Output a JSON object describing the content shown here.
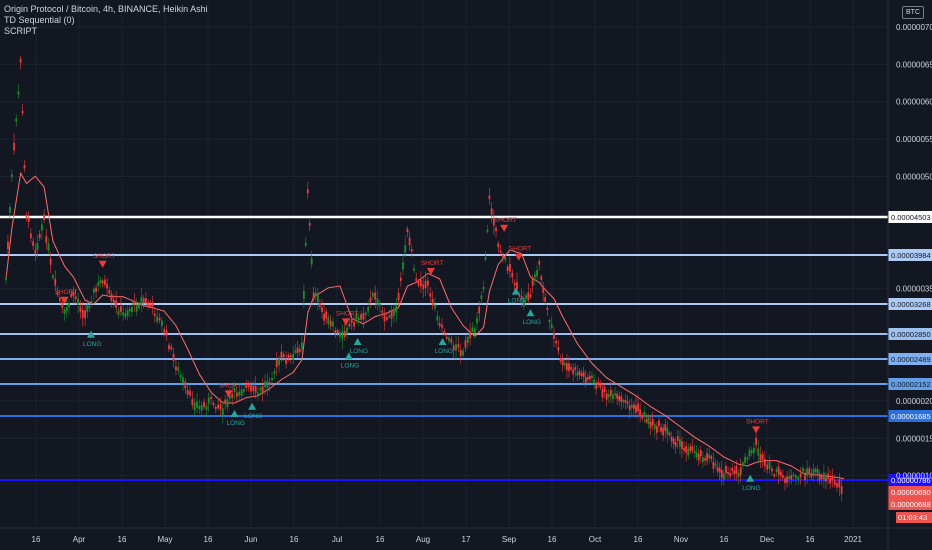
{
  "header": {
    "symbol_line": "Origin Protocol / Bitcoin, 4h, BINANCE, Heikin Ashi",
    "indicator_1": "TD Sequential (0)",
    "indicator_2": "SCRIPT",
    "currency_badge": "BTC"
  },
  "colors": {
    "background": "#131722",
    "up": "#26a69a",
    "up_candle": "#1b8f2a",
    "down": "#ef3a3a",
    "resistance_white": "#ffffff",
    "line_light": "#aecbf6",
    "line_mid": "#64a0e8",
    "line_strong": "#2962ff",
    "line_blue_deep": "#1b10ff",
    "ma_line": "#ff6b6b",
    "axis_text": "#d1d4dc",
    "countdown_bg": "#ef5350"
  },
  "chart_data": {
    "type": "candlestick",
    "title": "Origin Protocol / Bitcoin, 4h, BINANCE, Heikin Ashi",
    "y_axis": {
      "unit": "BTC",
      "range": [
        3e-07,
        7.2e-06
      ],
      "ticks": [
        "0.00000700",
        "0.00000650",
        "0.00000600",
        "0.00000550",
        "0.00000500",
        "0.00000350",
        "0.00000200",
        "0.00000150",
        "0.00000100"
      ],
      "tick_values": [
        7e-06,
        6.5e-06,
        6e-06,
        5.5e-06,
        5e-06,
        3.5e-06,
        2e-06,
        1.5e-06,
        1e-06
      ]
    },
    "x_axis": {
      "labels": [
        "16",
        "Apr",
        "16",
        "May",
        "16",
        "Jun",
        "16",
        "Jul",
        "16",
        "Aug",
        "17",
        "Sep",
        "16",
        "Oct",
        "16",
        "Nov",
        "16",
        "Dec",
        "16",
        "2021"
      ]
    },
    "horizontal_levels": [
      {
        "value": 4.503e-05,
        "label": "0.00004503",
        "color": "#ffffff"
      },
      {
        "value": 3.984e-05,
        "label": "0.00003984",
        "color": "#aecbf6"
      },
      {
        "value": 3.268e-05,
        "label": "0.00003268",
        "color": "#aecbf6"
      },
      {
        "value": 2.85e-05,
        "label": "0.00002850",
        "color": "#9cc0f0"
      },
      {
        "value": 2.489e-05,
        "label": "0.00002489",
        "color": "#7fb0f0"
      },
      {
        "value": 2.152e-05,
        "label": "0.00002152",
        "color": "#64a0e8"
      },
      {
        "value": 1.685e-05,
        "label": "0.00001685",
        "color": "#2a6fdc"
      },
      {
        "value": 7.86e-06,
        "label": "0.00000786",
        "color": "#1b10ff"
      }
    ],
    "price_tags": [
      {
        "label": "0.00000690",
        "color": "#ef5350"
      },
      {
        "label": "0.00000688",
        "color": "#ef5350"
      }
    ],
    "countdown": "01:03:43",
    "price_path": [
      [
        0,
        3.6e-06
      ],
      [
        0.2,
        5e-06
      ],
      [
        0.5,
        6.6e-06
      ],
      [
        0.7,
        4.5e-06
      ],
      [
        1,
        4e-06
      ],
      [
        1.3,
        4.4e-06
      ],
      [
        1.6,
        3.6e-06
      ],
      [
        2,
        3.1e-06
      ],
      [
        2.3,
        3.4e-06
      ],
      [
        2.7,
        3.1e-06
      ],
      [
        3,
        3.4e-06
      ],
      [
        3.3,
        3.6e-06
      ],
      [
        3.6,
        3.3e-06
      ],
      [
        4,
        3.1e-06
      ],
      [
        4.3,
        3.2e-06
      ],
      [
        4.7,
        3.3e-06
      ],
      [
        5,
        3.2e-06
      ],
      [
        5.4,
        2.9e-06
      ],
      [
        5.8,
        2.4e-06
      ],
      [
        6.2,
        2e-06
      ],
      [
        6.6,
        1.8e-06
      ],
      [
        7,
        1.9e-06
      ],
      [
        7.4,
        1.8e-06
      ],
      [
        7.8,
        2e-06
      ],
      [
        8.2,
        2.1e-06
      ],
      [
        8.6,
        2e-06
      ],
      [
        9,
        2.2e-06
      ],
      [
        9.4,
        2.5e-06
      ],
      [
        9.8,
        2.5e-06
      ],
      [
        10.1,
        2.7e-06
      ],
      [
        10.3,
        4.8e-06
      ],
      [
        10.5,
        3.4e-06
      ],
      [
        11,
        3e-06
      ],
      [
        11.4,
        2.8e-06
      ],
      [
        11.8,
        3e-06
      ],
      [
        12.2,
        3.1e-06
      ],
      [
        12.6,
        3.4e-06
      ],
      [
        13,
        3e-06
      ],
      [
        13.4,
        3.3e-06
      ],
      [
        13.7,
        4.3e-06
      ],
      [
        14,
        3.6e-06
      ],
      [
        14.4,
        3.5e-06
      ],
      [
        14.8,
        3e-06
      ],
      [
        15.2,
        2.7e-06
      ],
      [
        15.6,
        2.6e-06
      ],
      [
        16,
        2.9e-06
      ],
      [
        16.3,
        3.5e-06
      ],
      [
        16.5,
        4.7e-06
      ],
      [
        16.8,
        4.1e-06
      ],
      [
        17.2,
        3.7e-06
      ],
      [
        17.6,
        3.3e-06
      ],
      [
        17.9,
        3.4e-06
      ],
      [
        18.2,
        3.8e-06
      ],
      [
        18.4,
        3.3e-06
      ],
      [
        18.7,
        2.8e-06
      ],
      [
        19,
        2.4e-06
      ],
      [
        19.5,
        2.3e-06
      ],
      [
        20,
        2.2e-06
      ],
      [
        20.5,
        2e-06
      ],
      [
        21,
        1.9e-06
      ],
      [
        21.5,
        1.8e-06
      ],
      [
        22,
        1.6e-06
      ],
      [
        22.5,
        1.5e-06
      ],
      [
        23,
        1.3e-06
      ],
      [
        23.5,
        1.2e-06
      ],
      [
        24,
        1.1e-06
      ],
      [
        24.5,
        9e-07
      ],
      [
        25,
        9e-07
      ],
      [
        25.3,
        1.1e-06
      ],
      [
        25.6,
        1.3e-06
      ],
      [
        25.9,
        1e-06
      ],
      [
        26.3,
        9e-07
      ],
      [
        26.8,
        8e-07
      ],
      [
        27.2,
        9e-07
      ],
      [
        27.7,
        9e-07
      ],
      [
        28.2,
        8e-07
      ],
      [
        28.6,
        7e-07
      ]
    ],
    "signals": [
      {
        "x": 2.0,
        "type": "SHORT"
      },
      {
        "x": 2.9,
        "type": "LONG"
      },
      {
        "x": 3.3,
        "type": "SHORT"
      },
      {
        "x": 7.6,
        "type": "SHORT"
      },
      {
        "x": 7.8,
        "type": "LONG"
      },
      {
        "x": 8.4,
        "type": "LONG"
      },
      {
        "x": 11.6,
        "type": "SHORT"
      },
      {
        "x": 11.7,
        "type": "LONG"
      },
      {
        "x": 12.0,
        "type": "LONG"
      },
      {
        "x": 14.5,
        "type": "SHORT"
      },
      {
        "x": 14.9,
        "type": "LONG"
      },
      {
        "x": 17.0,
        "type": "SHORT"
      },
      {
        "x": 17.5,
        "type": "SHORT"
      },
      {
        "x": 17.4,
        "type": "LONG"
      },
      {
        "x": 17.9,
        "type": "LONG"
      },
      {
        "x": 25.6,
        "type": "SHORT"
      },
      {
        "x": 25.4,
        "type": "LONG"
      }
    ]
  }
}
